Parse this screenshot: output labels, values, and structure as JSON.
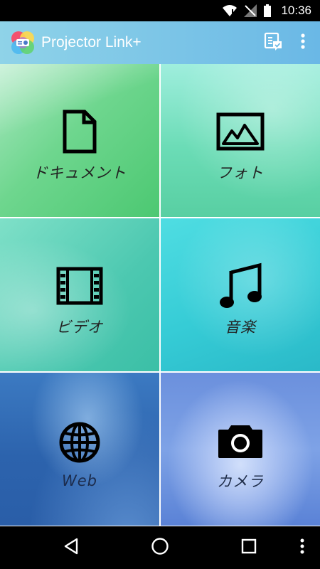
{
  "status_bar": {
    "time": "10:36",
    "icons": [
      "wifi-icon",
      "no-signal-icon",
      "battery-icon"
    ]
  },
  "app_bar": {
    "title": "Projector Link+",
    "logo": "projector-link-logo",
    "actions": [
      "device-connect-icon",
      "more-vert-icon"
    ]
  },
  "tiles": [
    {
      "label": "ドキュメント",
      "icon": "document-icon"
    },
    {
      "label": "フォト",
      "icon": "photo-icon"
    },
    {
      "label": "ビデオ",
      "icon": "video-icon"
    },
    {
      "label": "音楽",
      "icon": "music-icon"
    },
    {
      "label": "Web",
      "icon": "globe-icon"
    },
    {
      "label": "カメラ",
      "icon": "camera-icon"
    }
  ],
  "nav_bar": {
    "buttons": [
      "back-icon",
      "home-icon",
      "recents-icon",
      "overflow-icon"
    ]
  },
  "colors": {
    "app_bar_start": "#8fd3e8",
    "app_bar_end": "#6ab8e6",
    "label_color": "#222222"
  }
}
